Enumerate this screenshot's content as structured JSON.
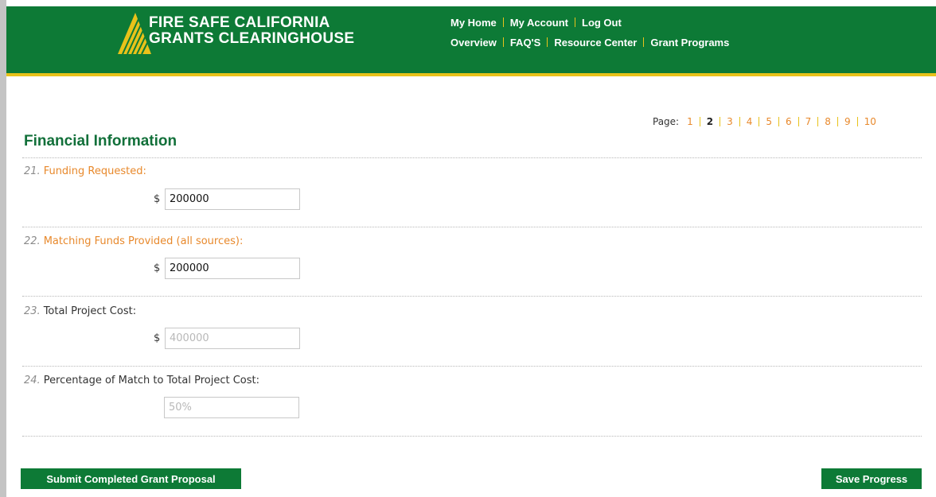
{
  "brand": {
    "line1": "FIRE SAFE CALIFORNIA",
    "line2": "GRANTS CLEARINGHOUSE",
    "logo_icon": "flame-stripes-icon"
  },
  "nav": {
    "row1": [
      "My Home",
      "My Account",
      "Log Out"
    ],
    "row2": [
      "Overview",
      "FAQ'S",
      "Resource Center",
      "Grant Programs"
    ]
  },
  "pager": {
    "label": "Page:",
    "pages": [
      "1",
      "2",
      "3",
      "4",
      "5",
      "6",
      "7",
      "8",
      "9",
      "10"
    ],
    "current": "2"
  },
  "section": {
    "title": "Financial Information"
  },
  "questions": [
    {
      "num": "21.",
      "label": "Funding Requested:",
      "currency": "$",
      "value": "200000"
    },
    {
      "num": "22.",
      "label": "Matching Funds Provided (all sources):",
      "currency": "$",
      "value": "200000"
    },
    {
      "num": "23.",
      "label": "Total Project Cost:",
      "currency": "$",
      "value": "400000"
    },
    {
      "num": "24.",
      "label": "Percentage of Match to Total Project Cost:",
      "value": "50%"
    }
  ],
  "buttons": {
    "submit": "Submit Completed Grant Proposal",
    "save": "Save Progress"
  },
  "colors": {
    "brand_green": "#0d7a36",
    "accent_gold": "#e8c21a",
    "link_orange": "#e8892c"
  }
}
